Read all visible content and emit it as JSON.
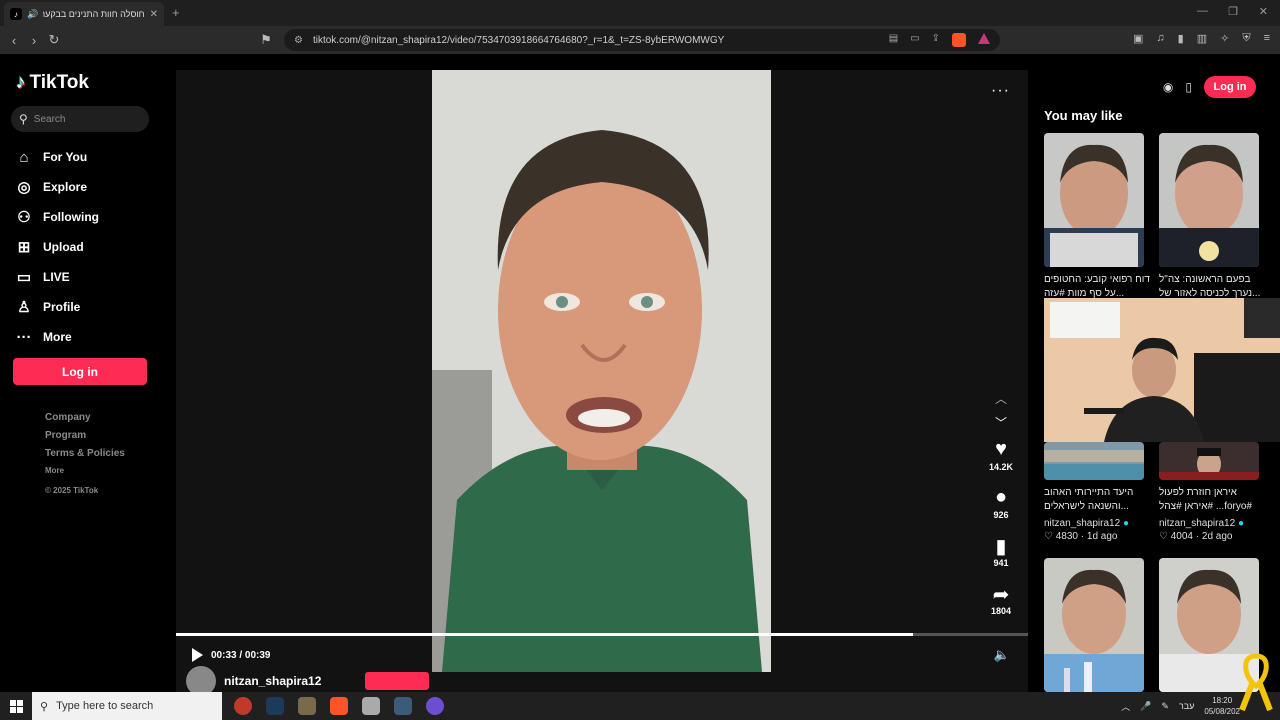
{
  "browser": {
    "tab_title": "חוסלה חוות התנינים בבקעת",
    "new_tab": "+",
    "url": "tiktok.com/@nitzan_shapira12/video/7534703918664764680?_r=1&_t=ZS-8ybERWOMWGY"
  },
  "sidebar": {
    "logo": "TikTok",
    "search_placeholder": "Search",
    "items": [
      {
        "label": "For You",
        "icon": "home-icon"
      },
      {
        "label": "Explore",
        "icon": "compass-icon"
      },
      {
        "label": "Following",
        "icon": "user-plus-icon"
      },
      {
        "label": "Upload",
        "icon": "plus-square-icon"
      },
      {
        "label": "LIVE",
        "icon": "tv-icon"
      },
      {
        "label": "Profile",
        "icon": "user-icon"
      },
      {
        "label": "More",
        "icon": "more-dots-icon"
      }
    ],
    "login_label": "Log in",
    "footer": {
      "company": "Company",
      "program": "Program",
      "terms": "Terms & Policies",
      "more": "More",
      "copyright": "© 2025 TikTok"
    }
  },
  "video": {
    "likes": "14.2K",
    "comments": "926",
    "saves": "941",
    "shares": "1804",
    "time": "00:33 / 00:39",
    "progress": 0.865,
    "author": "nitzan_shapira12"
  },
  "right_panel": {
    "login_label": "Log in",
    "heading": "You may like",
    "cards": [
      {
        "caption_1": "דוח רפואי קובע: החטופים",
        "caption_2": "...על סף מוות #עזה"
      },
      {
        "caption_1": "בפעם הראשונה: צה\"ל",
        "caption_2": "...נערך לכניסה לאזור של"
      },
      {
        "caption_1": "היעד התיירותי האהוב",
        "caption_2": "...והשנאה לישראלים",
        "author": "nitzan_shapira12",
        "likes": "4830",
        "age": "1d ago"
      },
      {
        "caption_1": "איראן חוזרת לפעול",
        "caption_2": "#foryo... #איראן #צהל",
        "author": "nitzan_shapira12",
        "likes": "4004",
        "age": "2d ago"
      }
    ]
  },
  "taskbar": {
    "search_text": "Type here to search",
    "lang": "עבר",
    "time": "18:20",
    "date": "05/08/202"
  }
}
